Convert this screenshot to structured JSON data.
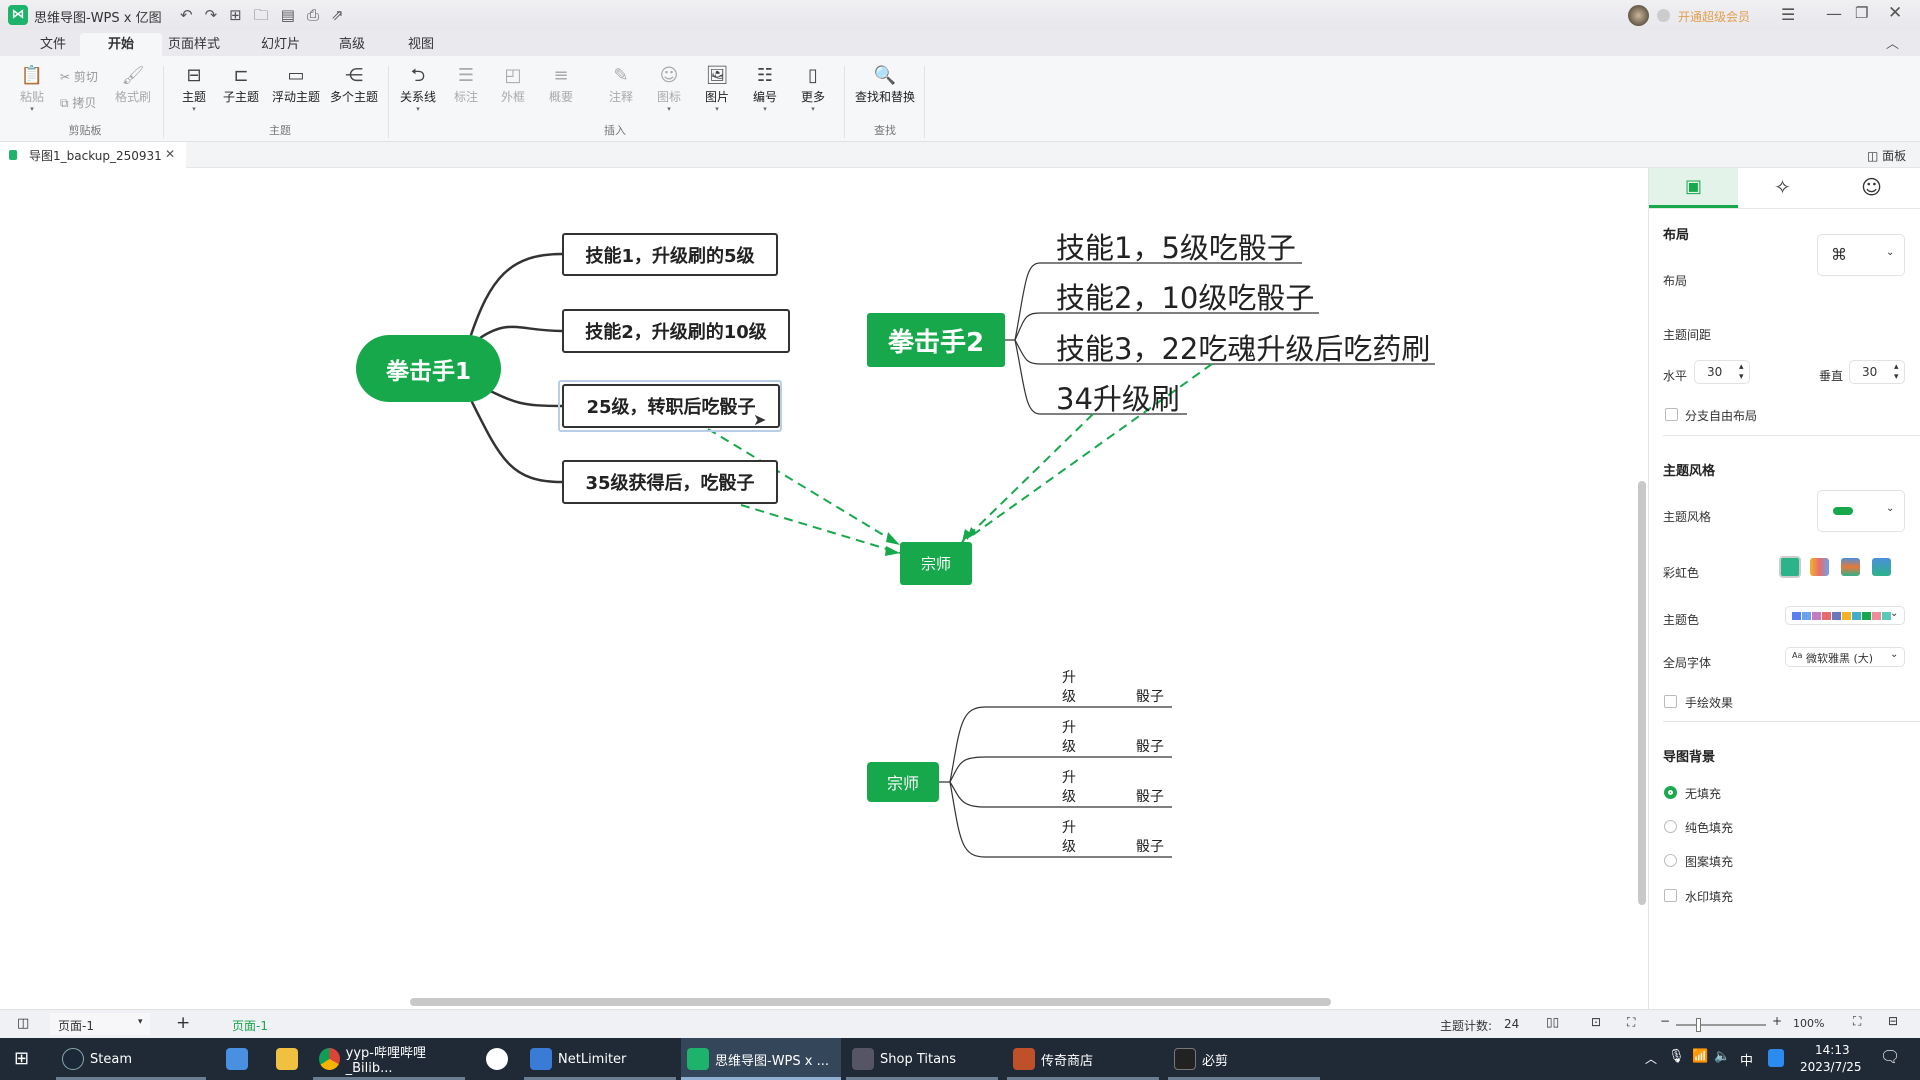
{
  "app": {
    "title": "思维导图-WPS x 亿图",
    "vip": "开通超级会员"
  },
  "menu_tabs": [
    "文件",
    "开始",
    "页面样式",
    "幻灯片",
    "高级",
    "视图"
  ],
  "ribbon": {
    "clipboard": {
      "paste": "粘贴",
      "cut": "剪切",
      "copy": "拷贝",
      "format_painter": "格式刷",
      "group": "剪贴板"
    },
    "topic": {
      "topic": "主题",
      "subtopic": "子主题",
      "floating": "浮动主题",
      "multiple": "多个主题",
      "group": "主题"
    },
    "insert": {
      "relation": "关系线",
      "callout": "标注",
      "boundary": "外框",
      "summary": "概要",
      "note": "注释",
      "icon": "图标",
      "image": "图片",
      "numbering": "编号",
      "more": "更多",
      "group": "插入"
    },
    "find": {
      "find_replace": "查找和替换",
      "group": "查找"
    }
  },
  "doc_tab": {
    "name": "导图1_backup_250931",
    "panel_toggle": "面板"
  },
  "mindmap": {
    "boxer1": {
      "label": "拳击手1",
      "children": [
        "技能1，升级刷的5级",
        "技能2，升级刷的10级",
        "25级，转职后吃骰子",
        "35级获得后，吃骰子"
      ]
    },
    "boxer2": {
      "label": "拳击手2",
      "children": [
        "技能1，5级吃骰子",
        "技能2，10级吃骰子",
        "技能3，22吃魂升级后吃药刷",
        "34升级刷"
      ]
    },
    "master_small": {
      "label": "宗师"
    },
    "master": {
      "label": "宗师",
      "children": [
        {
          "a": "升",
          "b": "级",
          "c": "骰子"
        },
        {
          "a": "升",
          "b": "级",
          "c": "骰子"
        },
        {
          "a": "升",
          "b": "级",
          "c": "骰子"
        },
        {
          "a": "升",
          "b": "级",
          "c": "骰子"
        }
      ]
    },
    "accent": "#18a84c"
  },
  "panel": {
    "layout_head": "布局",
    "layout_label": "布局",
    "spacing_label": "主题间距",
    "horizontal_label": "水平",
    "horizontal_value": "30",
    "vertical_label": "垂直",
    "vertical_value": "30",
    "free_layout": "分支自由布局",
    "style_head": "主题风格",
    "style_label": "主题风格",
    "rainbow_label": "彩虹色",
    "theme_color_label": "主题色",
    "font_label": "全局字体",
    "font_value": "微软雅黑 (大)",
    "font_prefix": "Aa",
    "hand_drawn": "手绘效果",
    "bg_head": "导图背景",
    "bg_options": [
      "无填充",
      "纯色填充",
      "图案填充",
      "水印填充"
    ],
    "bg_selected": "无填充",
    "theme_colors": [
      "#5b7ff0",
      "#6aa2f0",
      "#c77cc0",
      "#e86b6b",
      "#6a78b8",
      "#f0b429",
      "#3fb0c8",
      "#18a84c",
      "#ef8a9a",
      "#5cc8b8"
    ]
  },
  "status": {
    "page_select": "页面-1",
    "page_tab": "页面-1",
    "topic_count_label": "主题计数:",
    "topic_count": "24",
    "zoom": "100%"
  },
  "taskbar": {
    "items": [
      "Steam",
      "",
      "",
      "yyp-哔哩哔哩_Bilib...",
      "",
      "NetLimiter",
      "思维导图-WPS x ...",
      "Shop Titans",
      "传奇商店",
      "必剪"
    ],
    "time": "14:13",
    "date": "2023/7/25",
    "ime": "中"
  }
}
